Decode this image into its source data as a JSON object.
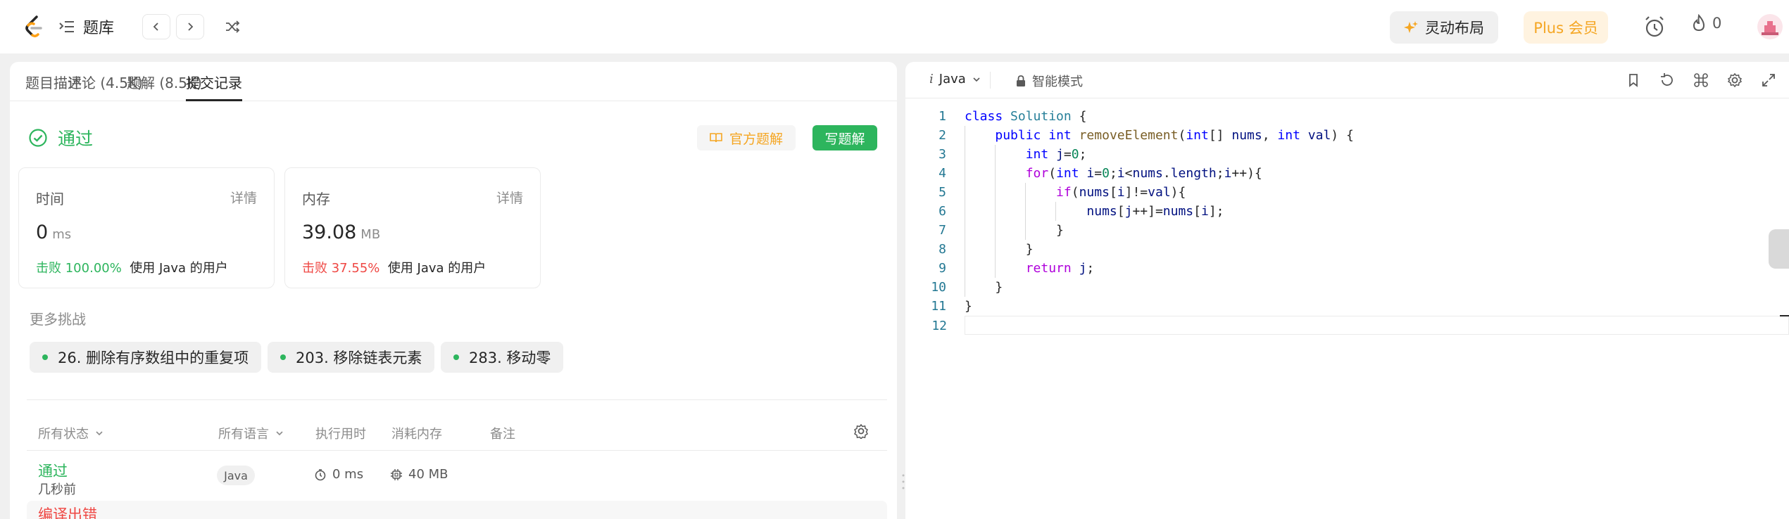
{
  "topbar": {
    "menu_label": "题库",
    "layout_button": "灵动布局",
    "plus_button": "Plus 会员",
    "streak_count": "0"
  },
  "left": {
    "tabs": [
      {
        "label": "题目描述"
      },
      {
        "label": "评论 (4.5K)"
      },
      {
        "label": "题解 (8.5K)"
      },
      {
        "label": "提交记录"
      }
    ],
    "status": "通过",
    "official_solution": "官方题解",
    "write_solution": "写题解",
    "runtime": {
      "title": "时间",
      "detail": "详情",
      "value": "0",
      "unit": "ms",
      "beat_prefix": "击败",
      "beat_pct": "100.00%",
      "beat_suffix": "使用 Java 的用户"
    },
    "memory": {
      "title": "内存",
      "detail": "详情",
      "value": "39.08",
      "unit": "MB",
      "beat_prefix": "击败",
      "beat_pct": "37.55%",
      "beat_suffix": "使用 Java 的用户"
    },
    "more_challenges": "更多挑战",
    "challenges": [
      {
        "label": "26. 删除有序数组中的重复项"
      },
      {
        "label": "203. 移除链表元素"
      },
      {
        "label": "283. 移动零"
      }
    ],
    "table_headers": {
      "status": "所有状态",
      "language": "所有语言",
      "runtime": "执行用时",
      "memory": "消耗内存",
      "notes": "备注"
    },
    "rows": [
      {
        "status": "通过",
        "time": "几秒前",
        "language": "Java",
        "runtime": "0 ms",
        "memory": "40 MB"
      },
      {
        "status": "编译出错"
      }
    ]
  },
  "editor": {
    "language": "Java",
    "mode": "智能模式",
    "lines": [
      "1",
      "2",
      "3",
      "4",
      "5",
      "6",
      "7",
      "8",
      "9",
      "10",
      "11",
      "12"
    ]
  },
  "colors": {
    "accepted": "#2db55d",
    "error": "#ef4743",
    "plus": "#f5a623"
  },
  "icons": [
    "leetcode-logo-icon",
    "list-icon",
    "chevron-left-icon",
    "chevron-right-icon",
    "shuffle-icon",
    "sparkle-icon",
    "alarm-icon",
    "fire-icon",
    "avatar",
    "check-circle-icon",
    "book-icon",
    "chevron-down-icon",
    "settings-icon",
    "clock-icon",
    "chip-icon",
    "lock-icon",
    "bookmark-icon",
    "reset-icon",
    "command-icon",
    "gear-icon",
    "expand-icon"
  ]
}
